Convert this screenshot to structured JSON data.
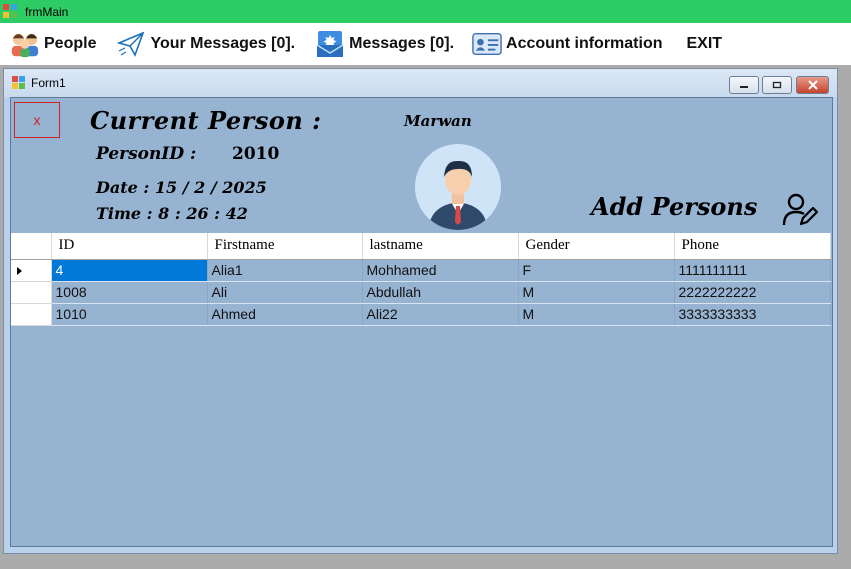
{
  "window": {
    "title": "frmMain"
  },
  "menu": {
    "items": [
      {
        "label": "People",
        "icon": "people-icon"
      },
      {
        "label": "Your Messages [0].",
        "icon": "paper-plane-icon"
      },
      {
        "label": "Messages [0].",
        "icon": "envelope-icon"
      },
      {
        "label": "Account information",
        "icon": "id-card-icon"
      },
      {
        "label": "EXIT"
      }
    ]
  },
  "form": {
    "title": "Form1",
    "close_x": "x",
    "current_label": "Current Person :",
    "person_id_label": "PersonID :",
    "person_id_value": "2010",
    "date_text": "Date : 15 / 2 / 2025",
    "time_text": "Time : 8 : 26 : 42",
    "username": "Marwan",
    "add_persons_label": "Add Persons"
  },
  "grid": {
    "columns": [
      "ID",
      "Firstname",
      "lastname",
      "Gender",
      "Phone"
    ],
    "rows": [
      [
        "4",
        "Alia1",
        "Mohhamed",
        "F",
        "1111111111"
      ],
      [
        "1008",
        "Ali",
        "Abdullah",
        "M",
        "2222222222"
      ],
      [
        "1010",
        "Ahmed",
        "Ali22",
        "M",
        "3333333333"
      ]
    ],
    "selected_row": 0
  },
  "colors": {
    "titlebar": "#2ecc65",
    "client_bg": "#96b3d1",
    "selection": "#0078d7",
    "close_red": "#cc2222"
  }
}
